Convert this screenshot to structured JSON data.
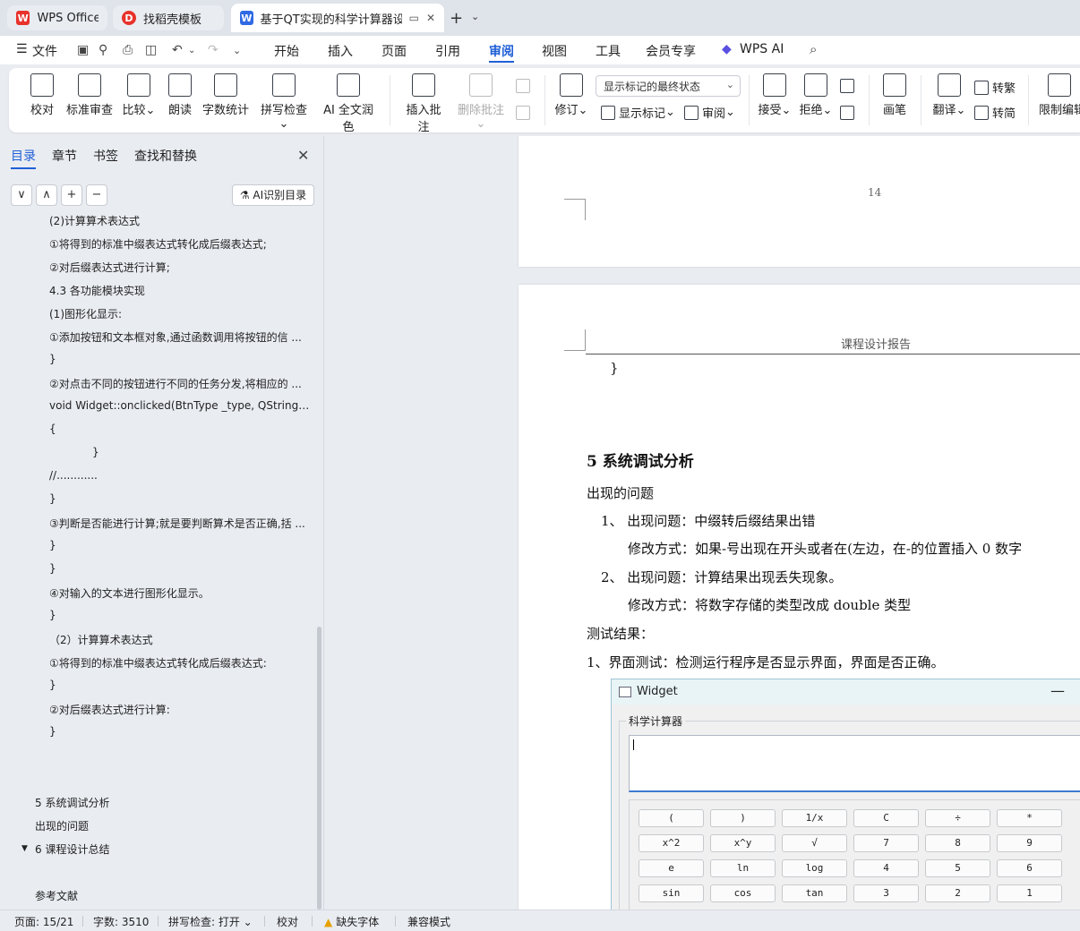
{
  "tabs": [
    {
      "title": "WPS Office",
      "icon": "wps-logo-icon"
    },
    {
      "title": "找稻壳模板",
      "icon": "docer-logo-icon"
    },
    {
      "title": "基于QT实现的科学计算器设计",
      "icon": "word-doc-icon",
      "active": true
    }
  ],
  "menu": {
    "file": "文件",
    "items": [
      "开始",
      "插入",
      "页面",
      "引用",
      "审阅",
      "视图",
      "工具",
      "会员专享",
      "WPS AI"
    ],
    "active": "审阅"
  },
  "ribbon": {
    "proofread": "校对",
    "standard_review": "标准审查",
    "compare": "比较",
    "read_aloud": "朗读",
    "word_count": "字数统计",
    "spell_check": "拼写检查",
    "ai_polish": "AI 全文润色",
    "insert_comment": "插入批注",
    "delete_comment": "删除批注",
    "track_changes": "修订",
    "markup_select": "显示标记的最终状态",
    "show_markup": "显示标记",
    "review_pane": "审阅",
    "accept": "接受",
    "reject": "拒绝",
    "pen": "画笔",
    "translate": "翻译",
    "to_traditional": "转繁",
    "to_simplified": "转简",
    "restrict_edit": "限制编辑"
  },
  "nav": {
    "tabs": [
      "目录",
      "章节",
      "书签",
      "查找和替换"
    ],
    "active": "目录",
    "ai_toc": "AI识别目录",
    "buttons": [
      "∨",
      "∧",
      "+",
      "−"
    ],
    "toc": [
      {
        "text": "(2)计算算术表达式",
        "indent": 55
      },
      {
        "text": "①将得到的标准中缀表达式转化成后缀表达式;",
        "indent": 55
      },
      {
        "text": "②对后缀表达式进行计算;",
        "indent": 55
      },
      {
        "text": "4.3  各功能模块实现",
        "indent": 55
      },
      {
        "text": "(1)图形化显示:",
        "indent": 55
      },
      {
        "text": "①添加按钮和文本框对象,通过函数调用将按钮的信 ...",
        "indent": 55
      },
      {
        "text": "}",
        "indent": 55
      },
      {
        "text": "②对点击不同的按钮进行不同的任务分发,将相应的 ...",
        "indent": 55
      },
      {
        "text": "void Widget::onclicked(BtnType _type, QString _ ...",
        "indent": 55
      },
      {
        "text": "{",
        "indent": 55
      },
      {
        "text": "}",
        "indent": 103
      },
      {
        "text": "//............",
        "indent": 55
      },
      {
        "text": "}",
        "indent": 55
      },
      {
        "text": "③判断是否能进行计算;就是要判断算术是否正确,括 ...",
        "indent": 55
      },
      {
        "text": "}",
        "indent": 55
      },
      {
        "text": "}",
        "indent": 55
      },
      {
        "text": "④对输入的文本进行图形化显示。",
        "indent": 55
      },
      {
        "text": "}",
        "indent": 55
      },
      {
        "text": "（2）计算算术表达式",
        "indent": 55
      },
      {
        "text": "①将得到的标准中缀表达式转化成后缀表达式:",
        "indent": 55
      },
      {
        "text": "}",
        "indent": 55
      },
      {
        "text": "②对后缀表达式进行计算:",
        "indent": 55
      },
      {
        "text": "}",
        "indent": 55
      },
      {
        "text": "",
        "indent": 55
      },
      {
        "text": "",
        "indent": 55
      },
      {
        "text": "5  系统调试分析",
        "indent": 39
      },
      {
        "text": "出现的问题",
        "indent": 39
      },
      {
        "text": "6  课程设计总结",
        "indent": 39,
        "collapsible": true
      },
      {
        "text": "",
        "indent": 39
      },
      {
        "text": "参考文献",
        "indent": 39
      }
    ]
  },
  "document": {
    "page_number": "14",
    "header_title": "课程设计报告",
    "brace": "}",
    "heading": "5  系统调试分析",
    "problems_title": "出现的问题",
    "p1_label": "1、  出现问题：中缀转后缀结果出错",
    "p1_fix": "修改方式：如果-号出现在开头或者在(左边，在-的位置插入 0 数字",
    "p2_label": "2、  出现问题：计算结果出现丢失现象。",
    "p2_fix": "修改方式：将数字存储的类型改成 double 类型",
    "test_title": "测试结果：",
    "test1": "1、界面测试：检测运行程序是否显示界面，界面是否正确。"
  },
  "widget": {
    "title": "Widget",
    "minimize": "—",
    "group_label": "科学计算器",
    "buttons": [
      [
        "(",
        ")",
        "1/x",
        "C",
        "÷",
        "*"
      ],
      [
        "x^2",
        "x^y",
        "√",
        "7",
        "8",
        "9"
      ],
      [
        "e",
        "ln",
        "log",
        "4",
        "5",
        "6"
      ],
      [
        "sin",
        "cos",
        "tan",
        "3",
        "2",
        "1"
      ]
    ]
  },
  "status": {
    "page": "页面: 15/21",
    "words": "字数: 3510",
    "spell": "拼写检查: 打开",
    "proof": "校对",
    "missing_font": "缺失字体",
    "compat": "兼容模式"
  },
  "colors": {
    "accent": "#1f5fd6",
    "wps_red": "#e8322b",
    "warning": "#e6a100"
  }
}
